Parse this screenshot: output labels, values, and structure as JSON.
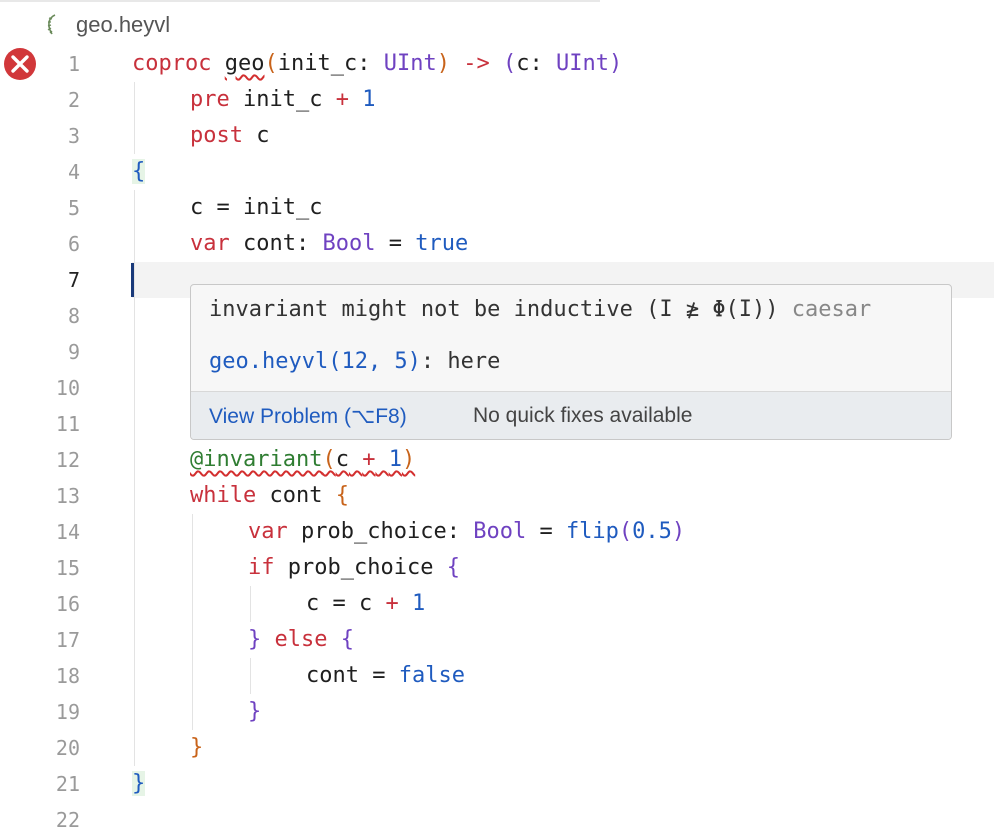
{
  "tab": {
    "filename": "geo.heyvl",
    "icon": "heyvl-file-icon"
  },
  "error_marker": {
    "icon": "error-circle-icon",
    "line": 1
  },
  "line_numbers": [
    "1",
    "2",
    "3",
    "4",
    "5",
    "6",
    "7",
    "8",
    "9",
    "10",
    "11",
    "12",
    "13",
    "14",
    "15",
    "16",
    "17",
    "18",
    "19",
    "20",
    "21",
    "22"
  ],
  "active_line": 7,
  "code": {
    "l1": {
      "kw": "coproc",
      "name": "geo",
      "p_open": "(",
      "param": "init_c",
      "colon": ":",
      "type1": "UInt",
      "p_close": ")",
      "arrow": "->",
      "r_open": "(",
      "ret": "c",
      "colon2": ":",
      "type2": "UInt",
      "r_close": ")"
    },
    "l2": {
      "kw": "pre",
      "expr": "init_c",
      "op": "+",
      "num": "1"
    },
    "l3": {
      "kw": "post",
      "expr": "c"
    },
    "l4": {
      "brace": "{"
    },
    "l5": {
      "lhs": "c",
      "eq": "=",
      "rhs": "init_c"
    },
    "l6": {
      "kw": "var",
      "name": "cont",
      "colon": ":",
      "type": "Bool",
      "eq": "=",
      "val": "true"
    },
    "l12": {
      "attr": "@invariant",
      "open": "(",
      "expr": "c",
      "op": "+",
      "num": "1",
      "close": ")"
    },
    "l13": {
      "kw": "while",
      "cond": "cont",
      "brace": "{"
    },
    "l14": {
      "kw": "var",
      "name": "prob_choice",
      "colon": ":",
      "type": "Bool",
      "eq": "=",
      "fn": "flip",
      "open": "(",
      "num": "0.5",
      "close": ")"
    },
    "l15": {
      "kw": "if",
      "cond": "prob_choice",
      "brace": "{"
    },
    "l16": {
      "lhs": "c",
      "eq": "=",
      "rhs": "c",
      "op": "+",
      "num": "1"
    },
    "l17": {
      "close": "}",
      "kw": "else",
      "open": "{"
    },
    "l18": {
      "lhs": "cont",
      "eq": "=",
      "val": "false"
    },
    "l19": {
      "brace": "}"
    },
    "l20": {
      "brace": "}"
    },
    "l21": {
      "brace": "}"
    }
  },
  "hover": {
    "message": "invariant might not be inductive (I ≱ Φ(I))",
    "source": "caesar",
    "location_link": "geo.heyvl(12, 5)",
    "location_suffix": ": here",
    "view_problem": "View Problem (⌥F8)",
    "no_fixes": "No quick fixes available"
  },
  "colors": {
    "keyword": "#c8313c",
    "type": "#6f42c1",
    "number": "#1f5bbf",
    "error": "#d32f2f",
    "attribute": "#2f7d32"
  }
}
